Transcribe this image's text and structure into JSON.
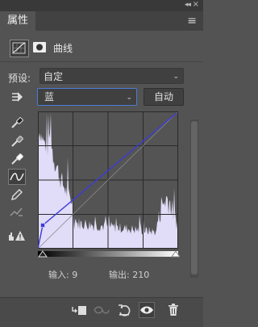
{
  "panel": {
    "tab_title": "属性",
    "adjustment_title": "曲线"
  },
  "preset": {
    "label": "预设:",
    "value": "自定"
  },
  "channel": {
    "value": "蓝"
  },
  "auto_button": {
    "label": "自动"
  },
  "io": {
    "input_label": "输入:",
    "input_value": "9",
    "output_label": "输出:",
    "output_value": "210"
  },
  "colors": {
    "panel_bg": "#535353",
    "histogram": "#e1dcf7",
    "curve": "#3c3cd6",
    "focus_border": "#4c7bd4"
  },
  "icons": {
    "tools": [
      "target-adjust-icon",
      "sample-black-eyedropper-icon",
      "sample-gray-eyedropper-icon",
      "sample-white-eyedropper-icon",
      "curve-point-tool-icon",
      "pencil-draw-icon",
      "smooth-curve-icon",
      "clipping-warning-icon"
    ],
    "bottom": [
      "clip-to-layer-icon",
      "view-previous-state-icon",
      "reset-icon",
      "visibility-eye-icon",
      "trash-icon"
    ]
  }
}
